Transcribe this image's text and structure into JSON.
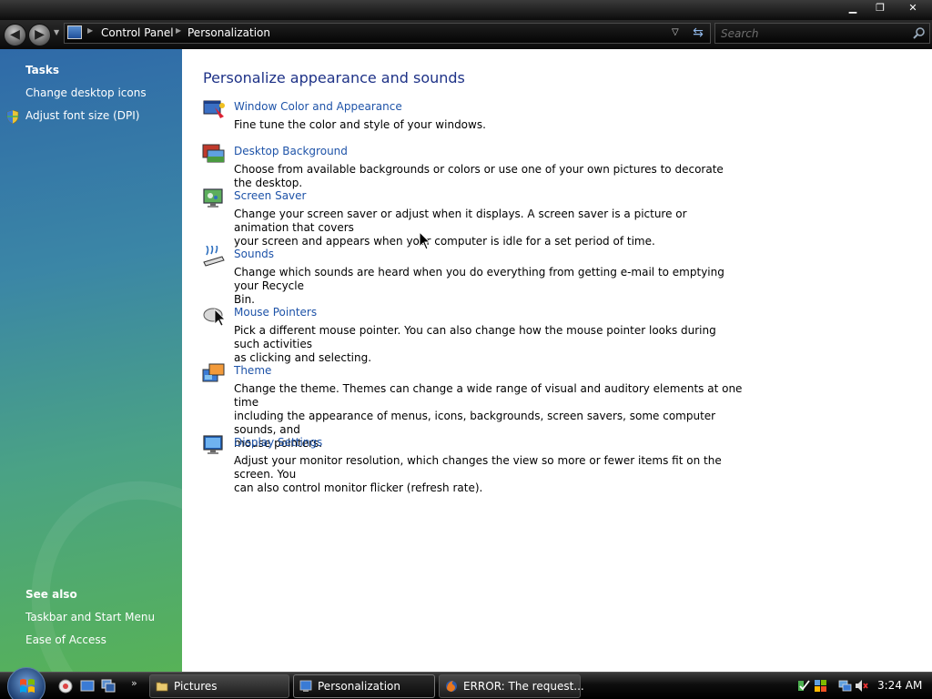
{
  "window": {
    "minimize_label": "▁",
    "maximize_label": "❐",
    "close_label": "✕"
  },
  "address_bar": {
    "back_label": "◀",
    "forward_label": "▶",
    "crumbs": [
      "Control Panel",
      "Personalization"
    ],
    "search_placeholder": "Search"
  },
  "tasks_pane": {
    "tasks_heading": "Tasks",
    "tasks": [
      "Change desktop icons",
      "Adjust font size (DPI)"
    ],
    "see_also_heading": "See also",
    "see_also": [
      "Taskbar and Start Menu",
      "Ease of Access"
    ]
  },
  "main": {
    "title": "Personalize appearance and sounds",
    "items": [
      {
        "title": "Window Color and Appearance",
        "desc": "Fine tune the color and style of your windows.",
        "icon": "window-color-icon"
      },
      {
        "title": "Desktop Background",
        "desc": "Choose from available backgrounds or colors or use one of your own pictures to decorate the desktop.",
        "icon": "desktop-background-icon"
      },
      {
        "title": "Screen Saver",
        "desc_line1": "Change your screen saver or adjust when it displays. A screen saver is a picture or animation that covers",
        "desc_line2": "your screen and appears when your computer is idle for a set period of time.",
        "icon": "screen-saver-icon"
      },
      {
        "title": "Sounds",
        "desc_line1": "Change which sounds are heard when you do everything from getting e-mail to emptying your Recycle",
        "desc_line2": "Bin.",
        "icon": "sounds-icon"
      },
      {
        "title": "Mouse Pointers",
        "desc_line1": "Pick a different mouse pointer. You can also change how the mouse pointer looks during such activities",
        "desc_line2": "as clicking and selecting.",
        "icon": "mouse-pointers-icon"
      },
      {
        "title": "Theme",
        "desc_line1": "Change the theme. Themes can change a wide range of visual and auditory elements at one time",
        "desc_line2": "including the appearance of menus, icons, backgrounds, screen savers, some computer sounds, and",
        "desc_line3": "mouse pointers.",
        "icon": "theme-icon"
      },
      {
        "title": "Display Settings",
        "desc_line1": "Adjust your monitor resolution, which changes the view so more or fewer items fit on the screen. You",
        "desc_line2": "can also control monitor flicker (refresh rate).",
        "icon": "display-settings-icon"
      }
    ]
  },
  "taskbar": {
    "quick_launch_more": "»",
    "tasks": [
      {
        "label": "Pictures",
        "icon": "folder-icon",
        "active": false
      },
      {
        "label": "Personalization",
        "icon": "control-panel-icon",
        "active": true
      },
      {
        "label": "ERROR: The request...",
        "icon": "firefox-icon",
        "active": false
      }
    ],
    "clock": "3:24 AM"
  }
}
